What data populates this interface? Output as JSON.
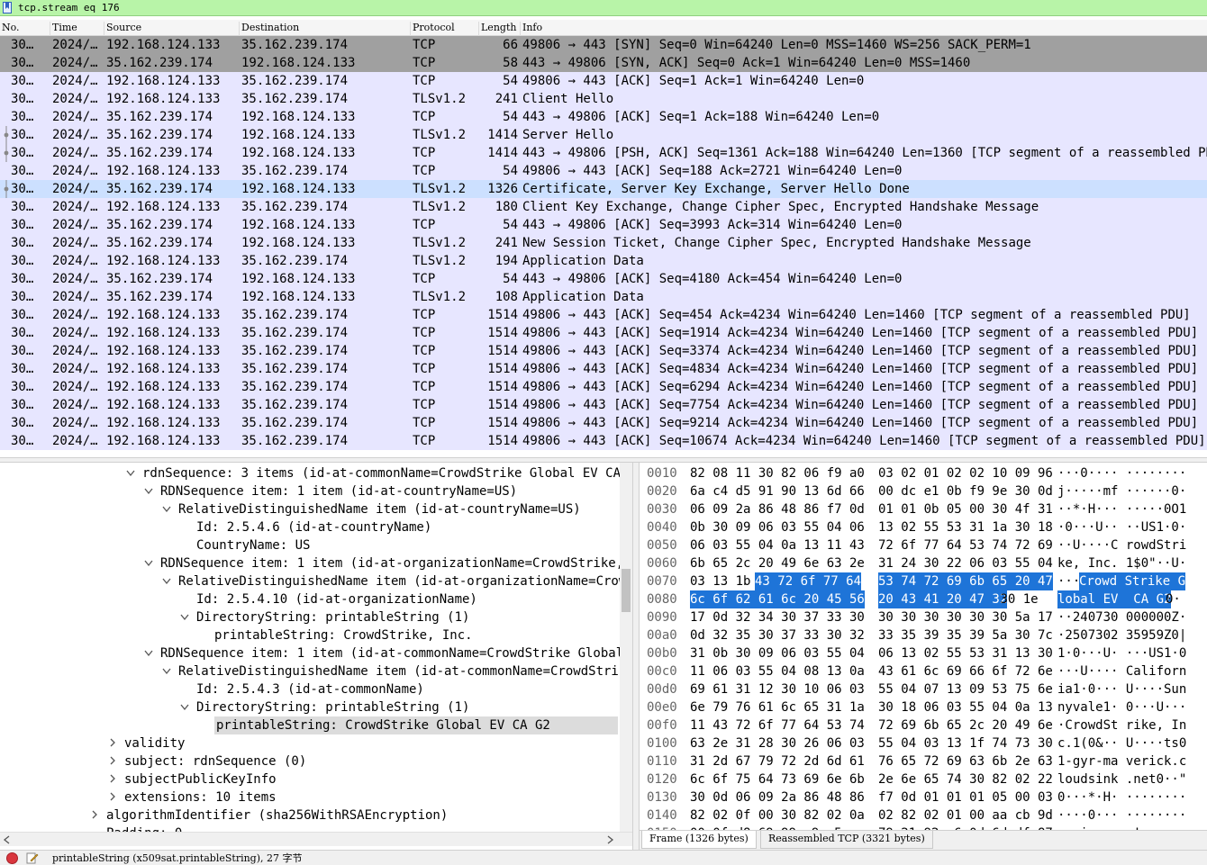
{
  "filter": {
    "value": "tcp.stream eq 176"
  },
  "columns": [
    "No.",
    "Time",
    "Source",
    "Destination",
    "Protocol",
    "Length",
    "Info"
  ],
  "colors": {
    "handshake_row": "#a0a0a0",
    "tcp_row": "#e7e6ff",
    "selected_row": "#cce0ff",
    "byte_highlight": "#1e74d8",
    "filter_bg": "#b8f4a8"
  },
  "packets": [
    {
      "no": "30…",
      "time": "2024/…",
      "src": "192.168.124.133",
      "dst": "35.162.239.174",
      "proto": "TCP",
      "len": "66",
      "info": "49806 → 443 [SYN] Seq=0 Win=64240 Len=0 MSS=1460 WS=256 SACK_PERM=1",
      "style": "hs"
    },
    {
      "no": "30…",
      "time": "2024/…",
      "src": "35.162.239.174",
      "dst": "192.168.124.133",
      "proto": "TCP",
      "len": "58",
      "info": "443 → 49806 [SYN, ACK] Seq=0 Ack=1 Win=64240 Len=0 MSS=1460",
      "style": "hs"
    },
    {
      "no": "30…",
      "time": "2024/…",
      "src": "192.168.124.133",
      "dst": "35.162.239.174",
      "proto": "TCP",
      "len": "54",
      "info": "49806 → 443 [ACK] Seq=1 Ack=1 Win=64240 Len=0",
      "style": "norm"
    },
    {
      "no": "30…",
      "time": "2024/…",
      "src": "192.168.124.133",
      "dst": "35.162.239.174",
      "proto": "TLSv1.2",
      "len": "241",
      "info": "Client Hello",
      "style": "norm"
    },
    {
      "no": "30…",
      "time": "2024/…",
      "src": "35.162.239.174",
      "dst": "192.168.124.133",
      "proto": "TCP",
      "len": "54",
      "info": "443 → 49806 [ACK] Seq=1 Ack=188 Win=64240 Len=0",
      "style": "norm"
    },
    {
      "no": "30…",
      "time": "2024/…",
      "src": "35.162.239.174",
      "dst": "192.168.124.133",
      "proto": "TLSv1.2",
      "len": "1414",
      "info": "Server Hello",
      "style": "norm",
      "mark": "dot"
    },
    {
      "no": "30…",
      "time": "2024/…",
      "src": "35.162.239.174",
      "dst": "192.168.124.133",
      "proto": "TCP",
      "len": "1414",
      "info": "443 → 49806 [PSH, ACK] Seq=1361 Ack=188 Win=64240 Len=1360 [TCP segment of a reassembled PDU]",
      "style": "norm",
      "mark": "dot"
    },
    {
      "no": "30…",
      "time": "2024/…",
      "src": "192.168.124.133",
      "dst": "35.162.239.174",
      "proto": "TCP",
      "len": "54",
      "info": "49806 → 443 [ACK] Seq=188 Ack=2721 Win=64240 Len=0",
      "style": "norm"
    },
    {
      "no": "30…",
      "time": "2024/…",
      "src": "35.162.239.174",
      "dst": "192.168.124.133",
      "proto": "TLSv1.2",
      "len": "1326",
      "info": "Certificate, Server Key Exchange, Server Hello Done",
      "style": "sel",
      "mark": "dot"
    },
    {
      "no": "30…",
      "time": "2024/…",
      "src": "192.168.124.133",
      "dst": "35.162.239.174",
      "proto": "TLSv1.2",
      "len": "180",
      "info": "Client Key Exchange, Change Cipher Spec, Encrypted Handshake Message",
      "style": "norm"
    },
    {
      "no": "30…",
      "time": "2024/…",
      "src": "35.162.239.174",
      "dst": "192.168.124.133",
      "proto": "TCP",
      "len": "54",
      "info": "443 → 49806 [ACK] Seq=3993 Ack=314 Win=64240 Len=0",
      "style": "norm"
    },
    {
      "no": "30…",
      "time": "2024/…",
      "src": "35.162.239.174",
      "dst": "192.168.124.133",
      "proto": "TLSv1.2",
      "len": "241",
      "info": "New Session Ticket, Change Cipher Spec, Encrypted Handshake Message",
      "style": "norm"
    },
    {
      "no": "30…",
      "time": "2024/…",
      "src": "192.168.124.133",
      "dst": "35.162.239.174",
      "proto": "TLSv1.2",
      "len": "194",
      "info": "Application Data",
      "style": "norm"
    },
    {
      "no": "30…",
      "time": "2024/…",
      "src": "35.162.239.174",
      "dst": "192.168.124.133",
      "proto": "TCP",
      "len": "54",
      "info": "443 → 49806 [ACK] Seq=4180 Ack=454 Win=64240 Len=0",
      "style": "norm"
    },
    {
      "no": "30…",
      "time": "2024/…",
      "src": "35.162.239.174",
      "dst": "192.168.124.133",
      "proto": "TLSv1.2",
      "len": "108",
      "info": "Application Data",
      "style": "norm"
    },
    {
      "no": "30…",
      "time": "2024/…",
      "src": "192.168.124.133",
      "dst": "35.162.239.174",
      "proto": "TCP",
      "len": "1514",
      "info": "49806 → 443 [ACK] Seq=454 Ack=4234 Win=64240 Len=1460 [TCP segment of a reassembled PDU]",
      "style": "norm"
    },
    {
      "no": "30…",
      "time": "2024/…",
      "src": "192.168.124.133",
      "dst": "35.162.239.174",
      "proto": "TCP",
      "len": "1514",
      "info": "49806 → 443 [ACK] Seq=1914 Ack=4234 Win=64240 Len=1460 [TCP segment of a reassembled PDU]",
      "style": "norm"
    },
    {
      "no": "30…",
      "time": "2024/…",
      "src": "192.168.124.133",
      "dst": "35.162.239.174",
      "proto": "TCP",
      "len": "1514",
      "info": "49806 → 443 [ACK] Seq=3374 Ack=4234 Win=64240 Len=1460 [TCP segment of a reassembled PDU]",
      "style": "norm"
    },
    {
      "no": "30…",
      "time": "2024/…",
      "src": "192.168.124.133",
      "dst": "35.162.239.174",
      "proto": "TCP",
      "len": "1514",
      "info": "49806 → 443 [ACK] Seq=4834 Ack=4234 Win=64240 Len=1460 [TCP segment of a reassembled PDU]",
      "style": "norm"
    },
    {
      "no": "30…",
      "time": "2024/…",
      "src": "192.168.124.133",
      "dst": "35.162.239.174",
      "proto": "TCP",
      "len": "1514",
      "info": "49806 → 443 [ACK] Seq=6294 Ack=4234 Win=64240 Len=1460 [TCP segment of a reassembled PDU]",
      "style": "norm"
    },
    {
      "no": "30…",
      "time": "2024/…",
      "src": "192.168.124.133",
      "dst": "35.162.239.174",
      "proto": "TCP",
      "len": "1514",
      "info": "49806 → 443 [ACK] Seq=7754 Ack=4234 Win=64240 Len=1460 [TCP segment of a reassembled PDU]",
      "style": "norm"
    },
    {
      "no": "30…",
      "time": "2024/…",
      "src": "192.168.124.133",
      "dst": "35.162.239.174",
      "proto": "TCP",
      "len": "1514",
      "info": "49806 → 443 [ACK] Seq=9214 Ack=4234 Win=64240 Len=1460 [TCP segment of a reassembled PDU]",
      "style": "norm"
    },
    {
      "no": "30…",
      "time": "2024/…",
      "src": "192.168.124.133",
      "dst": "35.162.239.174",
      "proto": "TCP",
      "len": "1514",
      "info": "49806 → 443 [ACK] Seq=10674 Ack=4234 Win=64240 Len=1460 [TCP segment of a reassembled PDU]",
      "style": "norm"
    }
  ],
  "details": [
    {
      "lvl": 7,
      "tw": "open",
      "text": "rdnSequence: 3 items (id-at-commonName=CrowdStrike Global EV CA G2"
    },
    {
      "lvl": 8,
      "tw": "open",
      "text": "RDNSequence item: 1 item (id-at-countryName=US)"
    },
    {
      "lvl": 9,
      "tw": "open",
      "text": "RelativeDistinguishedName item (id-at-countryName=US)"
    },
    {
      "lvl": 10,
      "tw": "",
      "text": "Id: 2.5.4.6 (id-at-countryName)"
    },
    {
      "lvl": 10,
      "tw": "",
      "text": "CountryName: US"
    },
    {
      "lvl": 8,
      "tw": "open",
      "text": "RDNSequence item: 1 item (id-at-organizationName=CrowdStrike, I"
    },
    {
      "lvl": 9,
      "tw": "open",
      "text": "RelativeDistinguishedName item (id-at-organizationName=CrowdS"
    },
    {
      "lvl": 10,
      "tw": "",
      "text": "Id: 2.5.4.10 (id-at-organizationName)"
    },
    {
      "lvl": 10,
      "tw": "open",
      "text": "DirectoryString: printableString (1)"
    },
    {
      "lvl": 11,
      "tw": "",
      "text": "printableString: CrowdStrike, Inc."
    },
    {
      "lvl": 8,
      "tw": "open",
      "text": "RDNSequence item: 1 item (id-at-commonName=CrowdStrike Global E"
    },
    {
      "lvl": 9,
      "tw": "open",
      "text": "RelativeDistinguishedName item (id-at-commonName=CrowdStrike"
    },
    {
      "lvl": 10,
      "tw": "",
      "text": "Id: 2.5.4.3 (id-at-commonName)"
    },
    {
      "lvl": 10,
      "tw": "open",
      "text": "DirectoryString: printableString (1)"
    },
    {
      "lvl": 11,
      "tw": "",
      "text": "printableString: CrowdStrike Global EV CA G2",
      "hl": true
    },
    {
      "lvl": 6,
      "tw": "closed",
      "text": "validity"
    },
    {
      "lvl": 6,
      "tw": "closed",
      "text": "subject: rdnSequence (0)"
    },
    {
      "lvl": 6,
      "tw": "closed",
      "text": "subjectPublicKeyInfo"
    },
    {
      "lvl": 6,
      "tw": "closed",
      "text": "extensions: 10 items"
    },
    {
      "lvl": 5,
      "tw": "closed",
      "text": "algorithmIdentifier (sha256WithRSAEncryption)"
    },
    {
      "lvl": 5,
      "tw": "",
      "text": "Padding: 0"
    }
  ],
  "bytes": [
    {
      "off": "0010",
      "g1": "82 08 11 30 82 06 f9 a0",
      "g2": "03 02 01 02 02 10 09 96",
      "asc": "···0···· ········"
    },
    {
      "off": "0020",
      "g1": "6a c4 d5 91 90 13 6d 66",
      "g2": "00 dc e1 0b f9 9e 30 0d",
      "asc": "j·····mf ······0·"
    },
    {
      "off": "0030",
      "g1": "06 09 2a 86 48 86 f7 0d",
      "g2": "01 01 0b 05 00 30 4f 31",
      "asc": "··*·H··· ·····0O1"
    },
    {
      "off": "0040",
      "g1": "0b 30 09 06 03 55 04 06",
      "g2": "13 02 55 53 31 1a 30 18",
      "asc": "·0···U·· ··US1·0·"
    },
    {
      "off": "0050",
      "g1": "06 03 55 04 0a 13 11 43",
      "g2": "72 6f 77 64 53 74 72 69",
      "asc": "··U····C rowdStri"
    },
    {
      "off": "0060",
      "g1": "6b 65 2c 20 49 6e 63 2e",
      "g2": "31 24 30 22 06 03 55 04",
      "asc": "ke, Inc. 1$0\"··U·"
    },
    {
      "off": "0070",
      "g1a": "03 13 1b ",
      "g1h": "43 72 6f 77 64",
      "g2h": "53 74 72 69 6b 65 20 47",
      "asca": "···",
      "asch": "Crowd Strike G"
    },
    {
      "off": "0080",
      "g1h": "6c 6f 62 61 6c 20 45 56",
      "g2h": "20 43 41 20 47 32",
      "g2b": " 30 1e",
      "asch": "lobal EV  CA G2",
      "ascb": "0·"
    },
    {
      "off": "0090",
      "g1": "17 0d 32 34 30 37 33 30",
      "g2": "30 30 30 30 30 30 5a 17",
      "asc": "··240730 000000Z·"
    },
    {
      "off": "00a0",
      "g1": "0d 32 35 30 37 33 30 32",
      "g2": "33 35 39 35 39 5a 30 7c",
      "asc": "·2507302 35959Z0|"
    },
    {
      "off": "00b0",
      "g1": "31 0b 30 09 06 03 55 04",
      "g2": "06 13 02 55 53 31 13 30",
      "asc": "1·0···U· ···US1·0"
    },
    {
      "off": "00c0",
      "g1": "11 06 03 55 04 08 13 0a",
      "g2": "43 61 6c 69 66 6f 72 6e",
      "asc": "···U···· Californ"
    },
    {
      "off": "00d0",
      "g1": "69 61 31 12 30 10 06 03",
      "g2": "55 04 07 13 09 53 75 6e",
      "asc": "ia1·0··· U····Sun"
    },
    {
      "off": "00e0",
      "g1": "6e 79 76 61 6c 65 31 1a",
      "g2": "30 18 06 03 55 04 0a 13",
      "asc": "nyvale1· 0···U···"
    },
    {
      "off": "00f0",
      "g1": "11 43 72 6f 77 64 53 74",
      "g2": "72 69 6b 65 2c 20 49 6e",
      "asc": "·CrowdSt rike, In"
    },
    {
      "off": "0100",
      "g1": "63 2e 31 28 30 26 06 03",
      "g2": "55 04 03 13 1f 74 73 30",
      "asc": "c.1(0&·· U····ts0"
    },
    {
      "off": "0110",
      "g1": "31 2d 67 79 72 2d 6d 61",
      "g2": "76 65 72 69 63 6b 2e 63",
      "asc": "1-gyr-ma verick.c"
    },
    {
      "off": "0120",
      "g1": "6c 6f 75 64 73 69 6e 6b",
      "g2": "2e 6e 65 74 30 82 02 22",
      "asc": "loudsink .net0··\""
    },
    {
      "off": "0130",
      "g1": "30 0d 06 09 2a 86 48 86",
      "g2": "f7 0d 01 01 01 05 00 03",
      "asc": "0···*·H· ········"
    },
    {
      "off": "0140",
      "g1": "82 02 0f 00 30 82 02 0a",
      "g2": "02 82 02 01 00 aa cb 9d",
      "asc": "····0··· ········"
    },
    {
      "off": "0150",
      "g1": "00 0f d8 69 99 a9 a5 aa",
      "g2": "79 21 92 e6 0d 6d df 87",
      "asc": "···i···· y!···m··"
    },
    {
      "off": "0160",
      "g1": "a2 23 8f 35 d2 05 70 33",
      "g2": "d2 4b 2c a1 5f ed 99 f8",
      "asc": "·#·5··p3 ·K,·_···"
    }
  ],
  "byte_tabs": [
    "Frame (1326 bytes)",
    "Reassembled TCP (3321 bytes)"
  ],
  "status": {
    "text": "printableString (x509sat.printableString), 27 字节"
  }
}
